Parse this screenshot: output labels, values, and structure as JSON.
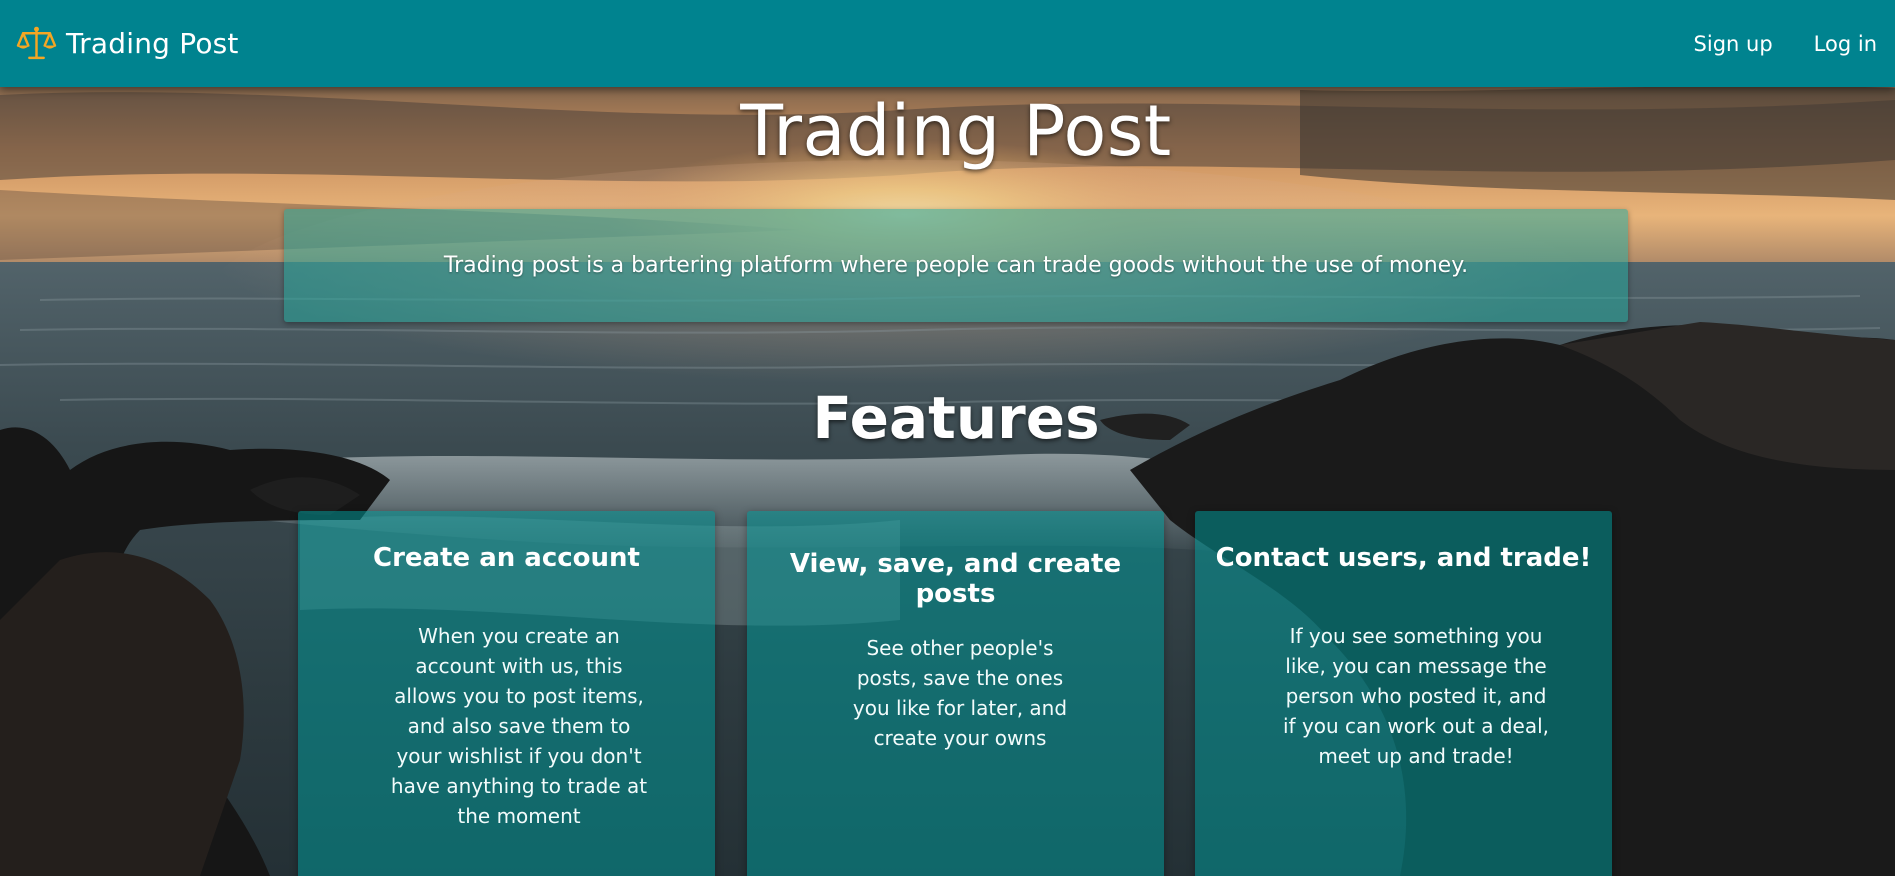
{
  "navbar": {
    "brand_name": "Trading Post",
    "brand_icon": "balance-scale-icon",
    "signup_label": "Sign up",
    "login_label": "Log in",
    "background_color": "#00838f"
  },
  "hero": {
    "title": "Trading Post",
    "intro": "Trading post is a bartering platform where people can trade goods without the use of money."
  },
  "features": {
    "title": "Features",
    "cards": [
      {
        "title": "Create an account",
        "text": "When you create an account with us, this allows you to post items, and also save them to your wishlist if you don't have anything to trade at the moment"
      },
      {
        "title": "View, save, and create posts",
        "text": "See other people's posts, save the ones you like for later, and create your owns"
      },
      {
        "title": "Contact users, and trade!",
        "text": "If you see something you like, you can message the person who posted it, and if you can work out a deal, meet up and trade!"
      }
    ]
  },
  "colors": {
    "accent": "#00838f",
    "card_tint": "#009696",
    "icon_gold": "#f5a623"
  }
}
